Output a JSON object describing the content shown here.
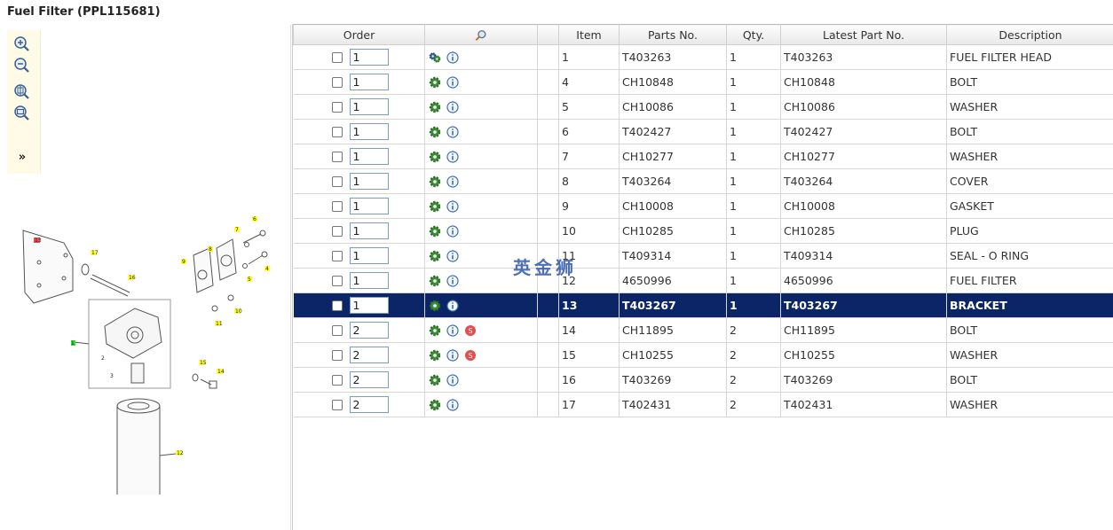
{
  "page_title": "Fuel Filter (PPL115681)",
  "toolbar": {
    "zoom_in_icon": "zoom-in-icon",
    "zoom_out_icon": "zoom-out-icon",
    "zoom_area_icon": "zoom-area-icon",
    "zoom_fit_icon": "zoom-fit-icon",
    "expand_label": "»"
  },
  "table": {
    "headers": {
      "order": "Order",
      "item": "Item",
      "parts_no": "Parts No.",
      "qty": "Qty.",
      "latest_part_no": "Latest Part No.",
      "description": "Description"
    },
    "rows": [
      {
        "order_qty": "1",
        "item": "1",
        "parts_no": "T403263",
        "qty": "1",
        "latest": "T403263",
        "desc": "FUEL FILTER HEAD"
      },
      {
        "order_qty": "1",
        "item": "4",
        "parts_no": "CH10848",
        "qty": "1",
        "latest": "CH10848",
        "desc": "BOLT"
      },
      {
        "order_qty": "1",
        "item": "5",
        "parts_no": "CH10086",
        "qty": "1",
        "latest": "CH10086",
        "desc": "WASHER"
      },
      {
        "order_qty": "1",
        "item": "6",
        "parts_no": "T402427",
        "qty": "1",
        "latest": "T402427",
        "desc": "BOLT"
      },
      {
        "order_qty": "1",
        "item": "7",
        "parts_no": "CH10277",
        "qty": "1",
        "latest": "CH10277",
        "desc": "WASHER"
      },
      {
        "order_qty": "1",
        "item": "8",
        "parts_no": "T403264",
        "qty": "1",
        "latest": "T403264",
        "desc": "COVER"
      },
      {
        "order_qty": "1",
        "item": "9",
        "parts_no": "CH10008",
        "qty": "1",
        "latest": "CH10008",
        "desc": "GASKET"
      },
      {
        "order_qty": "1",
        "item": "10",
        "parts_no": "CH10285",
        "qty": "1",
        "latest": "CH10285",
        "desc": "PLUG"
      },
      {
        "order_qty": "1",
        "item": "11",
        "parts_no": "T409314",
        "qty": "1",
        "latest": "T409314",
        "desc": "SEAL - O RING"
      },
      {
        "order_qty": "1",
        "item": "12",
        "parts_no": "4650996",
        "qty": "1",
        "latest": "4650996",
        "desc": "FUEL FILTER"
      },
      {
        "order_qty": "1",
        "item": "13",
        "parts_no": "T403267",
        "qty": "1",
        "latest": "T403267",
        "desc": "BRACKET"
      },
      {
        "order_qty": "2",
        "item": "14",
        "parts_no": "CH11895",
        "qty": "2",
        "latest": "CH11895",
        "desc": "BOLT"
      },
      {
        "order_qty": "2",
        "item": "15",
        "parts_no": "CH10255",
        "qty": "2",
        "latest": "CH10255",
        "desc": "WASHER"
      },
      {
        "order_qty": "2",
        "item": "16",
        "parts_no": "T403269",
        "qty": "2",
        "latest": "T403269",
        "desc": "BOLT"
      },
      {
        "order_qty": "2",
        "item": "17",
        "parts_no": "T402431",
        "qty": "2",
        "latest": "T402431",
        "desc": "WASHER"
      }
    ]
  },
  "watermark": "英金狮",
  "diagram_labels": [
    "13",
    "17",
    "16",
    "9",
    "8",
    "7",
    "6",
    "5",
    "4",
    "10",
    "11",
    "1",
    "2",
    "3",
    "15",
    "14",
    "12"
  ],
  "colors": {
    "selected_row": "#0b2566",
    "toolbar_bg": "#fffbe6",
    "gear": "#3f8f3a",
    "info": "#3a6fb0",
    "s_badge": "#e05050"
  }
}
